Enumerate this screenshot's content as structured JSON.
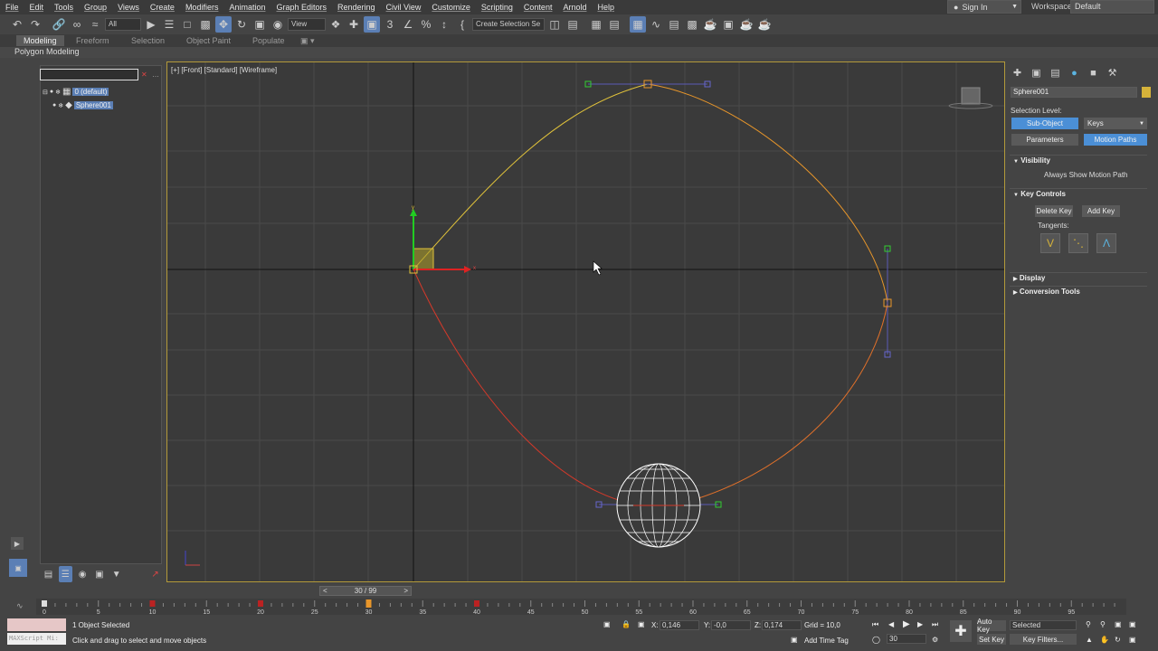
{
  "menubar": {
    "items": [
      "File",
      "Edit",
      "Tools",
      "Group",
      "Views",
      "Create",
      "Modifiers",
      "Animation",
      "Graph Editors",
      "Rendering",
      "Civil View",
      "Customize",
      "Scripting",
      "Content",
      "Arnold",
      "Help"
    ],
    "sign_in": "Sign In",
    "workspaces_label": "Workspaces:",
    "workspaces_value": "Default"
  },
  "toolbar": {
    "filter_value": "All",
    "refcoord_value": "View",
    "named_selection": "Create Selection Se"
  },
  "ribbon": {
    "tabs": [
      "Modeling",
      "Freeform",
      "Selection",
      "Object Paint",
      "Populate"
    ],
    "panel_label": "Polygon Modeling"
  },
  "explorer": {
    "layer_name": "0 (default)",
    "object_name": "Sphere001"
  },
  "viewport": {
    "label": "[+] [Front] [Standard] [Wireframe]"
  },
  "command_panel": {
    "object_name": "Sphere001",
    "selection_level_label": "Selection Level:",
    "sub_object_button": "Sub-Object",
    "keys_dropdown": "Keys",
    "parameters_button": "Parameters",
    "motion_paths_button": "Motion Paths",
    "visibility_rollout": "Visibility",
    "always_show_label": "Always Show Motion Path",
    "key_controls_rollout": "Key Controls",
    "delete_key_button": "Delete Key",
    "add_key_button": "Add Key",
    "tangents_label": "Tangents:",
    "display_rollout": "Display",
    "conversion_rollout": "Conversion Tools"
  },
  "timeline": {
    "frame_display": "30 / 99",
    "ticks": [
      "0",
      "5",
      "10",
      "15",
      "20",
      "25",
      "30",
      "35",
      "40",
      "45",
      "50",
      "55",
      "60",
      "65",
      "70",
      "75",
      "80",
      "85",
      "90",
      "95"
    ],
    "current_frame": 30
  },
  "statusbar": {
    "selection_status": "1 Object Selected",
    "prompt": "Click and drag to select and move objects",
    "maxscript_placeholder": "MAXScript Mi:",
    "x_label": "X:",
    "x_value": "0,146",
    "y_label": "Y:",
    "y_value": "-0,0",
    "z_label": "Z:",
    "z_value": "0,174",
    "grid": "Grid = 10,0",
    "add_time_tag": "Add Time Tag",
    "auto_key": "Auto Key",
    "set_key": "Set Key",
    "selected_dropdown": "Selected",
    "key_filters": "Key Filters...",
    "frame_field": "30"
  },
  "colors": {
    "accent_blue": "#4b8fd6",
    "selection_yellow": "#d6b33a",
    "viewport_border": "#b39a3a",
    "path_orange": "#e8962a",
    "path_red": "#d4392a"
  }
}
